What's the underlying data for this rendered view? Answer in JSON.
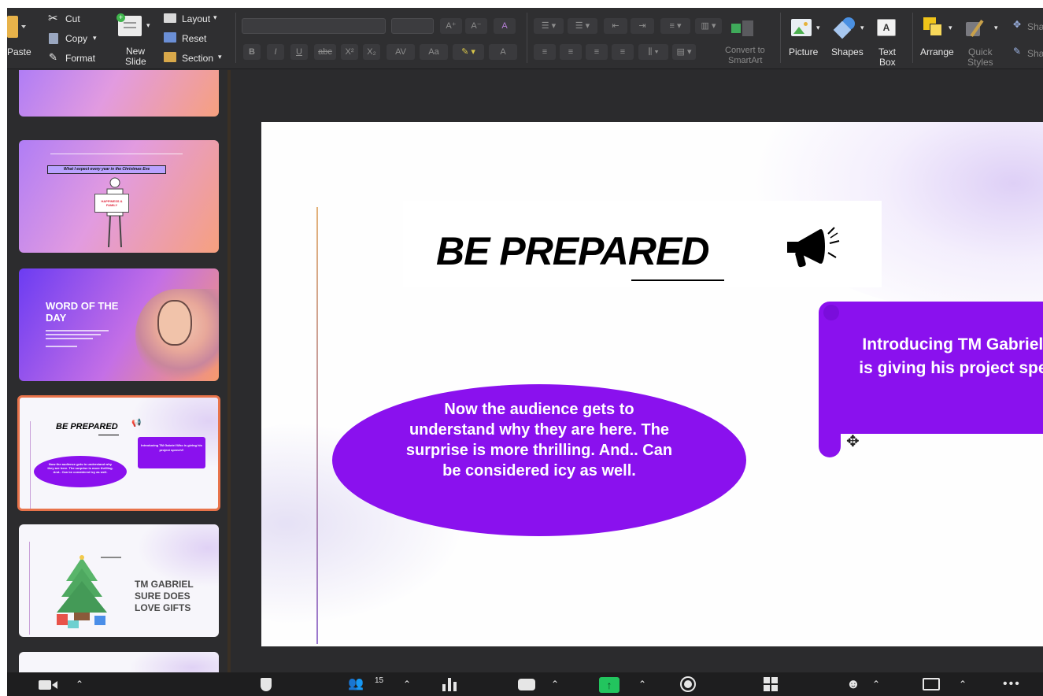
{
  "ribbon": {
    "paste": "Paste",
    "cut": "Cut",
    "copy": "Copy",
    "format": "Format",
    "new_slide": [
      "New",
      "Slide"
    ],
    "layout": "Layout",
    "reset": "Reset",
    "section": "Section",
    "convert": [
      "Convert to",
      "SmartArt"
    ],
    "picture": "Picture",
    "shapes": "Shapes",
    "text_box": [
      "Text",
      "Box"
    ],
    "arrange": "Arrange",
    "quick_styles": [
      "Quick",
      "Styles"
    ],
    "sha1": "Sha",
    "sha2": "Sha",
    "format_buttons": [
      "B",
      "I",
      "U",
      "abc",
      "X²",
      "X₂",
      "AV",
      "Aa",
      "A"
    ]
  },
  "thumbnails": {
    "t2_title": "What I expect every year in the Christmas Eve",
    "t2_sign": "HAPPINESS & FAMILY",
    "t3_title": "WORD OF THE DAY",
    "t4_title": "BE PREPARED",
    "t4_box": "Introducing TM Gabriel Who is giving his project speech!!",
    "t4_ellipse": "Now the audience gets to understand why they are here. The surprise is more thrilling. And.. Can be considered icy as well.",
    "t5_text": "TM GABRIEL SURE DOES LOVE GIFTS"
  },
  "slide": {
    "title": "BE PREPARED",
    "ellipse_text": "Now the audience gets to understand why they are here. The surprise is more thrilling. And.. Can be considered icy as well.",
    "box_text": "Introducing TM Gabriel Who is giving his project speech!!"
  },
  "toolbar": {
    "participants_count": "15"
  },
  "colors": {
    "accent_purple": "#8a11ee",
    "ribbon_bg": "#2f2f31",
    "selected_thumb_border": "#e8734a"
  }
}
